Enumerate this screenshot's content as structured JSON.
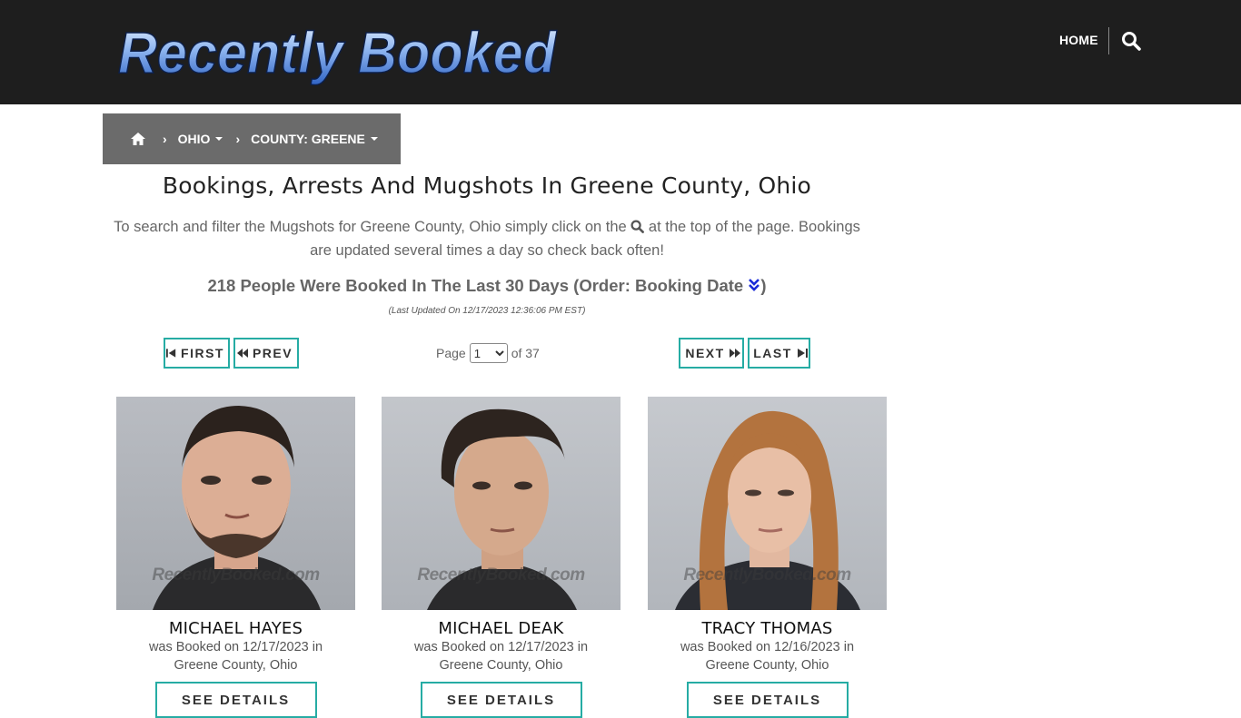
{
  "header": {
    "logo_text": "Recently Booked",
    "nav_home": "HOME",
    "search_icon": "search-icon"
  },
  "breadcrumb": {
    "home_icon": "home-icon",
    "state": "OHIO",
    "county": "COUNTY: GREENE"
  },
  "page": {
    "title": "Bookings, Arrests And Mugshots In Greene County, Ohio",
    "intro_before": "To search and filter the Mugshots for Greene County, Ohio simply click on the",
    "intro_after": "at the top of the page. Bookings are updated several times a day so check back often!",
    "count_text": "218 People Were Booked In The Last 30 Days (Order: Booking Date",
    "count_close": ")",
    "updated": "(Last Updated On 12/17/2023 12:36:06 PM EST)"
  },
  "pager": {
    "first": "FIRST",
    "prev": "PREV",
    "next": "NEXT",
    "last": "LAST",
    "page_label": "Page",
    "page_value": "1",
    "of_label": "of 37",
    "accent": "#26aca4"
  },
  "people": [
    {
      "name": "MICHAEL HAYES",
      "desc_line1": "was Booked on 12/17/2023 in",
      "desc_line2": "Greene County, Ohio",
      "watermark": "RecentlyBooked.com",
      "button": "SEE DETAILS"
    },
    {
      "name": "MICHAEL DEAK",
      "desc_line1": "was Booked on 12/17/2023 in",
      "desc_line2": "Greene County, Ohio",
      "watermark": "RecentlyBooked.com",
      "button": "SEE DETAILS"
    },
    {
      "name": "TRACY THOMAS",
      "desc_line1": "was Booked on 12/16/2023 in",
      "desc_line2": "Greene County, Ohio",
      "watermark": "RecentlyBooked.com",
      "button": "SEE DETAILS"
    }
  ]
}
